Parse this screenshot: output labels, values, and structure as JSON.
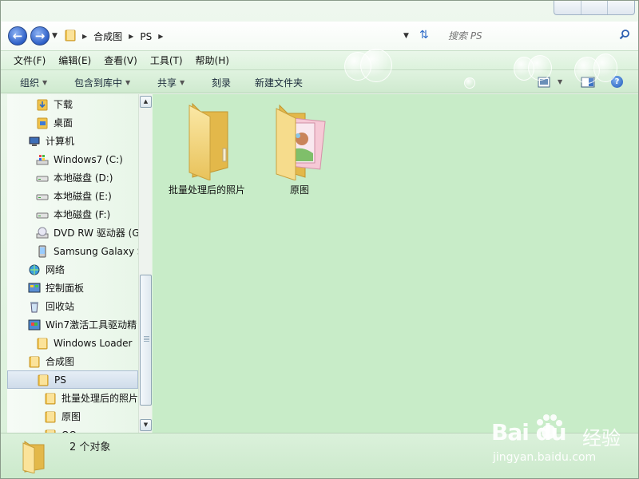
{
  "address": {
    "crumbs": [
      "合成图",
      "PS"
    ],
    "search_placeholder": "搜索 PS"
  },
  "menu": [
    "文件(F)",
    "编辑(E)",
    "查看(V)",
    "工具(T)",
    "帮助(H)"
  ],
  "commands": {
    "organize": "组织",
    "include_library": "包含到库中",
    "share": "共享",
    "burn": "刻录",
    "new_folder": "新建文件夹"
  },
  "nav": {
    "items": [
      {
        "label": "下载",
        "icon": "download-folder-icon"
      },
      {
        "label": "桌面",
        "icon": "desktop-folder-icon"
      },
      {
        "label": "计算机",
        "icon": "computer-icon"
      },
      {
        "label": "Windows7 (C:)",
        "icon": "system-drive-icon"
      },
      {
        "label": "本地磁盘 (D:)",
        "icon": "drive-icon"
      },
      {
        "label": "本地磁盘 (E:)",
        "icon": "drive-icon"
      },
      {
        "label": "本地磁盘 (F:)",
        "icon": "drive-icon"
      },
      {
        "label": "DVD RW 驱动器 (G",
        "icon": "dvd-drive-icon"
      },
      {
        "label": "Samsung Galaxy S",
        "icon": "phone-icon"
      },
      {
        "label": "网络",
        "icon": "network-icon"
      },
      {
        "label": "控制面板",
        "icon": "control-panel-icon"
      },
      {
        "label": "回收站",
        "icon": "recycle-bin-icon"
      },
      {
        "label": "Win7激活工具驱动精",
        "icon": "app-icon"
      },
      {
        "label": "Windows Loader",
        "icon": "folder-icon"
      },
      {
        "label": "合成图",
        "icon": "folder-icon"
      },
      {
        "label": "PS",
        "icon": "folder-icon"
      },
      {
        "label": "批量处理后的照片",
        "icon": "folder-icon"
      },
      {
        "label": "原图",
        "icon": "folder-icon"
      },
      {
        "label": "QQ",
        "icon": "folder-icon"
      }
    ]
  },
  "files": [
    {
      "label": "批量处理后的照片",
      "icon": "empty-folder-icon"
    },
    {
      "label": "原图",
      "icon": "photo-folder-icon"
    }
  ],
  "details": {
    "count": "2 个对象"
  },
  "watermark": {
    "logo": "Bai du",
    "cn": "经验",
    "url": "jingyan.baidu.com"
  }
}
